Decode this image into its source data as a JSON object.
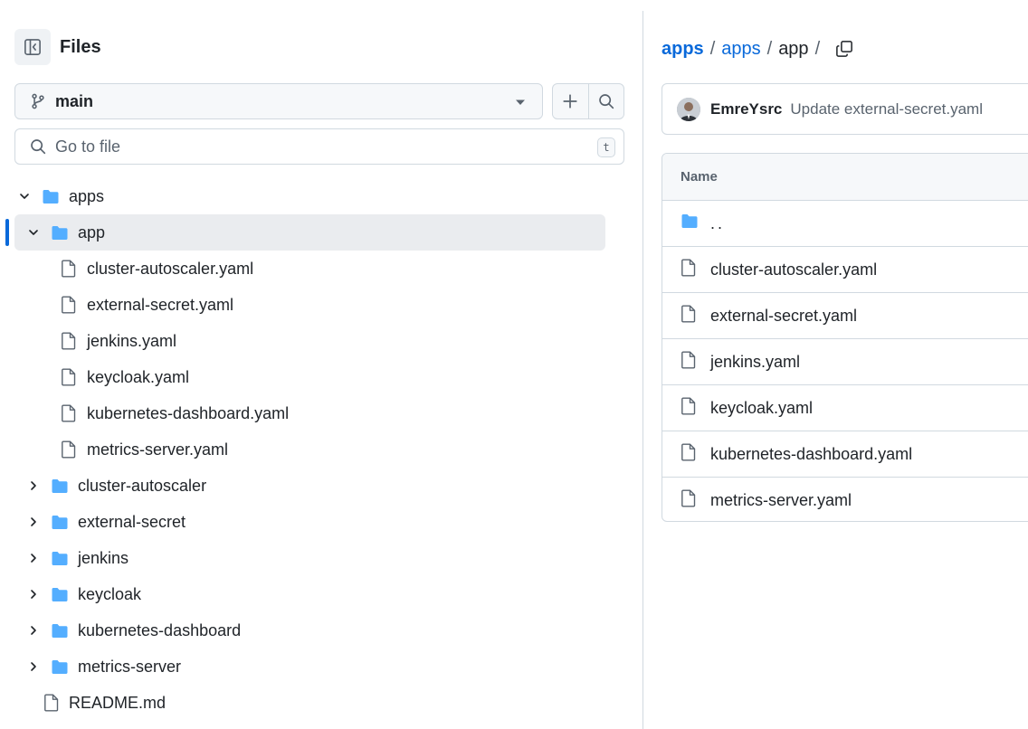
{
  "sidebar": {
    "title": "Files",
    "branch": "main",
    "search_placeholder": "Go to file",
    "search_shortcut": "t",
    "tree": [
      {
        "label": "apps",
        "type": "dir",
        "expanded": true
      },
      {
        "label": "app",
        "type": "dir",
        "expanded": true,
        "selected": true
      },
      {
        "label": "cluster-autoscaler.yaml",
        "type": "file"
      },
      {
        "label": "external-secret.yaml",
        "type": "file"
      },
      {
        "label": "jenkins.yaml",
        "type": "file"
      },
      {
        "label": "keycloak.yaml",
        "type": "file"
      },
      {
        "label": "kubernetes-dashboard.yaml",
        "type": "file"
      },
      {
        "label": "metrics-server.yaml",
        "type": "file"
      },
      {
        "label": "cluster-autoscaler",
        "type": "dir",
        "expanded": false
      },
      {
        "label": "external-secret",
        "type": "dir",
        "expanded": false
      },
      {
        "label": "jenkins",
        "type": "dir",
        "expanded": false
      },
      {
        "label": "keycloak",
        "type": "dir",
        "expanded": false
      },
      {
        "label": "kubernetes-dashboard",
        "type": "dir",
        "expanded": false
      },
      {
        "label": "metrics-server",
        "type": "dir",
        "expanded": false
      },
      {
        "label": "README.md",
        "type": "file"
      }
    ]
  },
  "breadcrumb": {
    "repo": "apps",
    "folder": "apps",
    "current": "app",
    "separator": "/"
  },
  "commit": {
    "author": "EmreYsrc",
    "message": "Update external-secret.yaml"
  },
  "table": {
    "header": "Name",
    "rows": [
      {
        "label": "..",
        "type": "dir"
      },
      {
        "label": "cluster-autoscaler.yaml",
        "type": "file"
      },
      {
        "label": "external-secret.yaml",
        "type": "file"
      },
      {
        "label": "jenkins.yaml",
        "type": "file"
      },
      {
        "label": "keycloak.yaml",
        "type": "file"
      },
      {
        "label": "kubernetes-dashboard.yaml",
        "type": "file"
      },
      {
        "label": "metrics-server.yaml",
        "type": "file"
      }
    ]
  },
  "colors": {
    "accent": "#0969da",
    "folder": "#54aeff",
    "text": "#1f2328",
    "muted": "#59636e",
    "border": "#d1d9e0",
    "selected_bg": "#eaecef"
  },
  "icons": {
    "sidebar_toggle": "sidebar-collapse-icon",
    "branch": "git-branch-icon",
    "caret": "triangle-down-icon",
    "plus": "plus-icon",
    "search": "search-icon",
    "folder": "folder-icon",
    "file": "file-icon",
    "chevron_down": "chevron-down-icon",
    "chevron_right": "chevron-right-icon",
    "copy": "copy-icon"
  }
}
